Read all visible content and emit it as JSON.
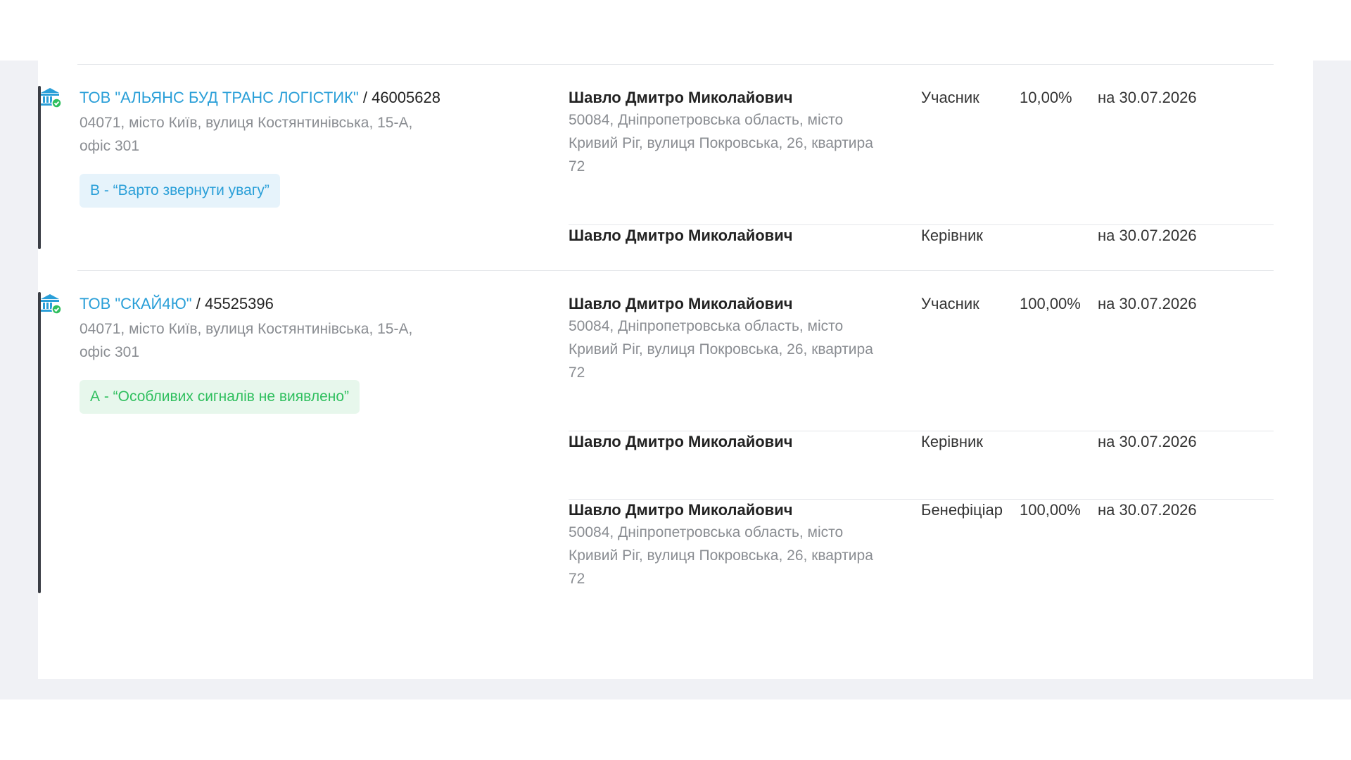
{
  "colors": {
    "accent_blue": "#2a9fd8",
    "risk_b_bg": "#e6f3fb",
    "risk_a_bg": "#e7f7ec",
    "risk_a_text": "#2fbf5e",
    "muted_text": "#8a8d92",
    "page_bg": "#f0f1f5"
  },
  "companies": [
    {
      "icon": "bank-verified-icon",
      "name": "ТОВ \"АЛЬЯНС БУД ТРАНС ЛОГІСТИК\"",
      "separator": " / ",
      "code": "46005628",
      "address": "04071, місто Київ, вулиця Костянтинівська, 15-А, офіс 301",
      "risk": "В - “Варто звернути увагу”",
      "persons": [
        {
          "name": "Шавло Дмитро Миколайович",
          "address": "50084, Дніпропетровська область, місто Кривий Ріг, вулиця Покровська, 26, квартира 72",
          "role": "Учасник",
          "share": "10,00%",
          "date": "на 30.07.2026"
        },
        {
          "name": "Шавло Дмитро Миколайович",
          "address": "",
          "role": "Керівник",
          "share": "",
          "date": "на 30.07.2026"
        }
      ]
    },
    {
      "icon": "bank-verified-icon",
      "name": "ТОВ \"СКАЙ4Ю\"",
      "separator": " / ",
      "code": "45525396",
      "address": "04071, місто Київ, вулиця Костянтинівська, 15-А, офіс 301",
      "risk": "А - “Особливих сигналів не виявлено”",
      "persons": [
        {
          "name": "Шавло Дмитро Миколайович",
          "address": "50084, Дніпропетровська область, місто Кривий Ріг, вулиця Покровська, 26, квартира 72",
          "role": "Учасник",
          "share": "100,00%",
          "date": "на 30.07.2026"
        },
        {
          "name": "Шавло Дмитро Миколайович",
          "address": "",
          "role": "Керівник",
          "share": "",
          "date": "на 30.07.2026"
        },
        {
          "name": "Шавло Дмитро Миколайович",
          "address": "50084, Дніпропетровська область, місто Кривий Ріг, вулиця Покровська, 26, квартира 72",
          "role": "Бенефіціар",
          "share": "100,00%",
          "date": "на 30.07.2026"
        }
      ]
    }
  ]
}
